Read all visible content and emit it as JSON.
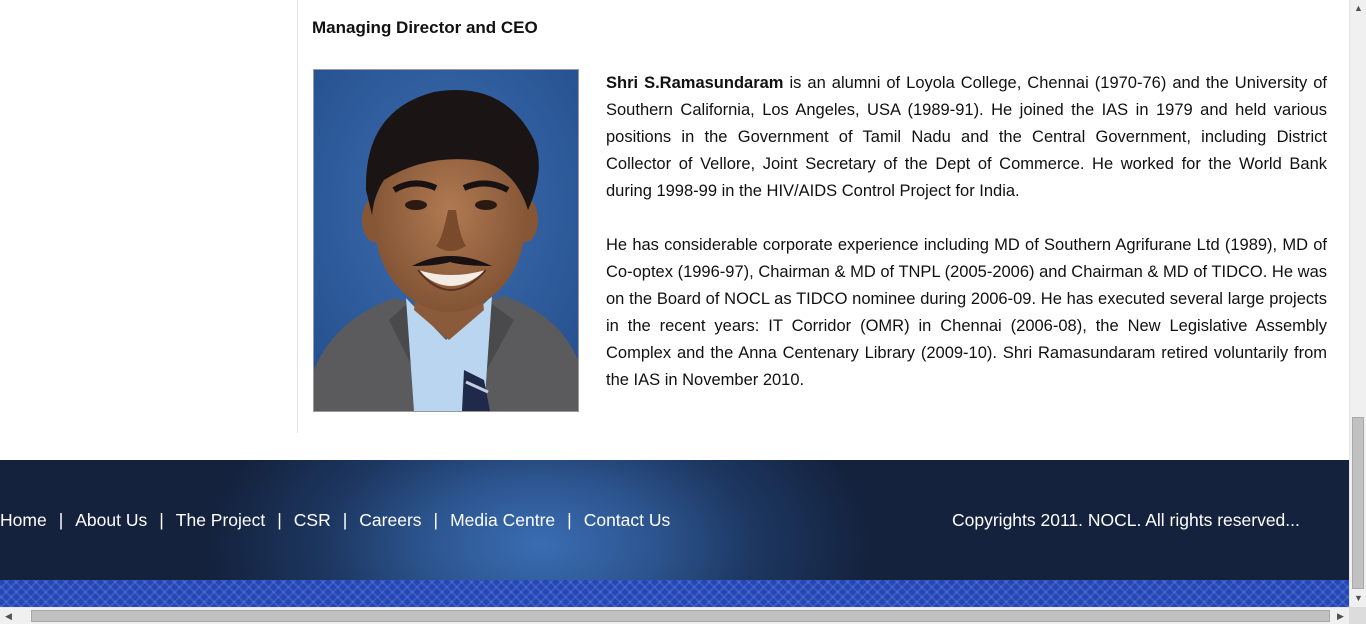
{
  "section": {
    "title": "Managing Director and CEO"
  },
  "bio": {
    "name": "Shri S.Ramasundaram",
    "p1_rest": " is an alumni of Loyola College, Chennai (1970-76) and the University of Southern California, Los Angeles, USA (1989-91). He joined the IAS in 1979 and held various positions in the Government of Tamil Nadu and the Central Government, including District Collector of Vellore, Joint Secretary of the Dept of Commerce. He worked for the World Bank during 1998-99 in the HIV/AIDS Control Project for India.",
    "p2": "He has considerable corporate experience including MD of Southern Agrifurane Ltd (1989), MD of Co-optex (1996-97), Chairman & MD of TNPL (2005-2006) and Chairman & MD of TIDCO. He was on the Board of NOCL as TIDCO nominee during 2006-09. He has executed several large projects in the recent years: IT Corridor (OMR) in Chennai (2006-08), the New Legislative Assembly Complex and the Anna Centenary Library (2009-10). Shri Ramasundaram retired voluntarily from the IAS in November 2010."
  },
  "footer": {
    "nav": [
      "Home",
      "About Us",
      "The Project",
      "CSR",
      "Careers",
      "Media Centre",
      "Contact Us"
    ],
    "separator": "|",
    "copyright": "Copyrights 2011. NOCL. All rights reserved..."
  },
  "colors": {
    "footer_dark": "#14223d",
    "footer_glow": "#3a6db3",
    "pattern_band": "#2447b8",
    "portrait_bg": "#2f5d9c"
  },
  "scrollbars": {
    "up_arrow": "▲",
    "down_arrow": "▼",
    "left_arrow": "◀",
    "right_arrow": "▶"
  }
}
